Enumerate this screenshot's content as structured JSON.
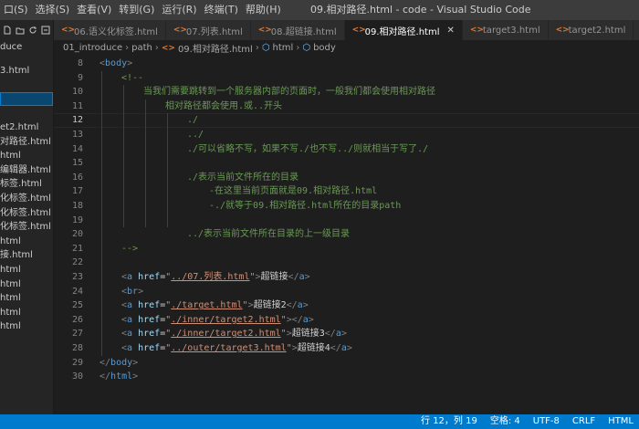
{
  "titlebar": {
    "menus": [
      "口(S)",
      "选择(S)",
      "查看(V)",
      "转到(G)",
      "运行(R)",
      "终端(T)",
      "帮助(H)"
    ],
    "window_title": "09.相对路径.html - code - Visual Studio Code"
  },
  "sidebar": {
    "items": [
      "duce",
      "",
      "3.html",
      "",
      "",
      "",
      "et2.html",
      "对路径.html",
      "html",
      "编辑器.html",
      "标签.html",
      "化标签.html",
      "化标签.html",
      "化标签.html",
      "html",
      "接.html",
      "html",
      "html",
      "html",
      "html",
      "html"
    ]
  },
  "tabs": [
    {
      "label": "06.语义化标签.html",
      "active": false
    },
    {
      "label": "07.列表.html",
      "active": false
    },
    {
      "label": "08.超链接.html",
      "active": false
    },
    {
      "label": "09.相对路径.html",
      "active": true
    },
    {
      "label": "target3.html",
      "active": false
    },
    {
      "label": "target2.html",
      "active": false
    },
    {
      "label": "ta",
      "active": false
    }
  ],
  "breadcrumb": [
    "01_introduce",
    "path",
    "09.相对路径.html",
    "html",
    "body"
  ],
  "editor": {
    "current_line": "12",
    "line_numbers": [
      "8",
      "9",
      "10",
      "11",
      "12",
      "13",
      "14",
      "15",
      "16",
      "17",
      "18",
      "19",
      "20",
      "21",
      "22",
      "23",
      "24",
      "25",
      "26",
      "27",
      "28",
      "29",
      "30"
    ],
    "comment": {
      "open": "<!--",
      "l10": "当我们需要跳转到一个服务器内部的页面时，一般我们都会使用相对路径",
      "l11": "相对路径都会使用.或..开头",
      "l12": "./",
      "l13": "../",
      "l14": "./可以省略不写，如果不写./也不写../则就相当于写了./",
      "l16": "./表示当前文件所在的目录",
      "l17": "-在这里当前页面就是09.相对路径.html",
      "l18": "-./就等于09.相对路径.html所在的目录path",
      "l20": "../表示当前文件所在目录的上一级目录",
      "close": "-->"
    },
    "links": [
      {
        "href": "../07.列表.html",
        "text": "超链接"
      },
      {
        "href": "./target.html",
        "text": "超链接2"
      },
      {
        "href": "./inner/target2.html",
        "text": ""
      },
      {
        "href": "./inner/target2.html",
        "text": "超链接3"
      },
      {
        "href": "../outer/target3.html",
        "text": "超链接4"
      }
    ]
  },
  "statusbar": {
    "position": "行 12，列 19",
    "spaces": "空格: 4",
    "encoding": "UTF-8",
    "eol": "CRLF",
    "language": "HTML"
  },
  "colors": {
    "statusbar": "#007acc",
    "comment": "#6a9955",
    "tag": "#569cd6",
    "attr": "#9cdcfe",
    "string": "#ce9178"
  }
}
